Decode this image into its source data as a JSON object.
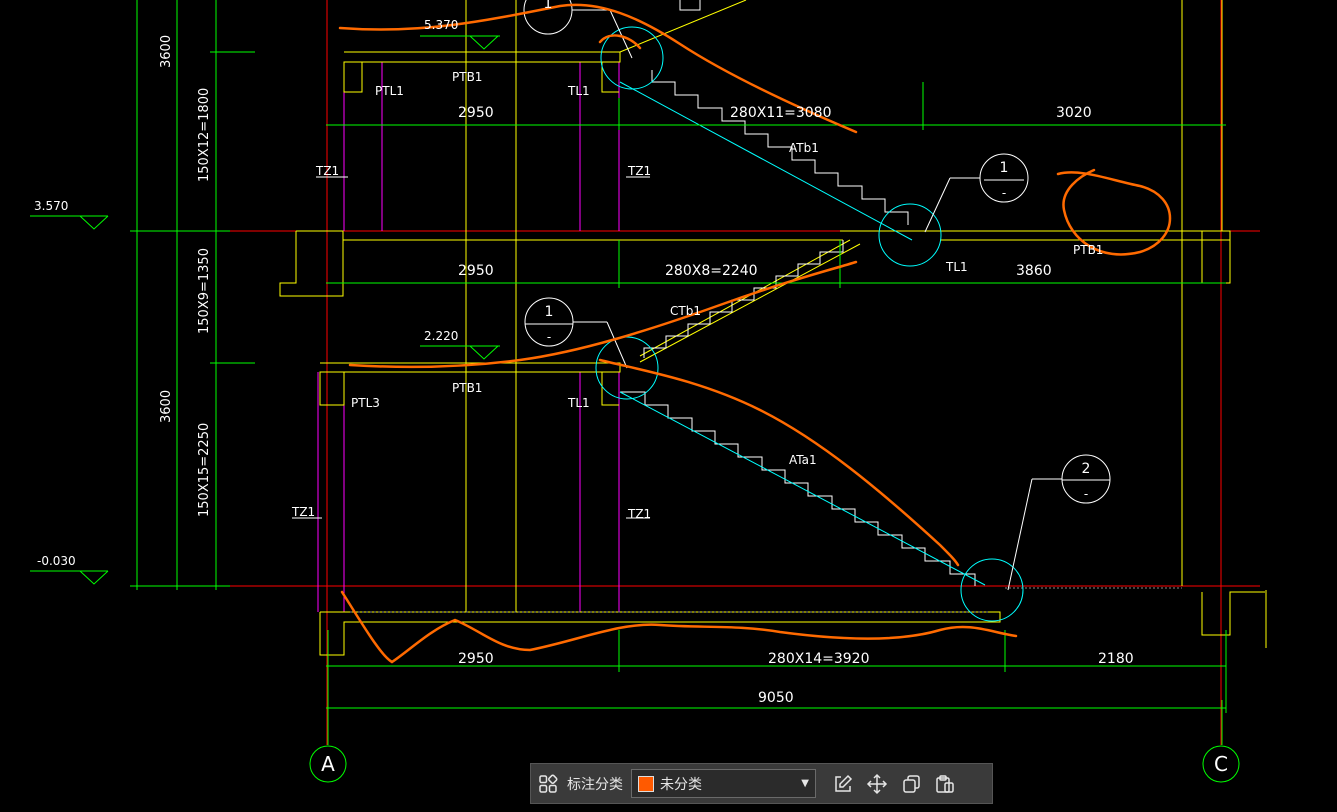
{
  "drawing": {
    "elevations": [
      "5.370",
      "3.570",
      "2.220",
      "-0.030"
    ],
    "vertical_dims": [
      "3600",
      "150X12=1800",
      "150X9=1350",
      "3600",
      "150X15=2250"
    ],
    "horizontal_dims": {
      "upper_left": "2950",
      "upper_run": "280X11=3080",
      "upper_right": "3020",
      "mid_left": "2950",
      "mid_run": "280X8=2240",
      "mid_right": "3860",
      "bottom_left": "2950",
      "bottom_run": "280X14=3920",
      "bottom_right": "2180",
      "total": "9050"
    },
    "labels": {
      "ptl1": "PTL1",
      "ptb1_top": "PTB1",
      "tl1_top": "TL1",
      "tz1_a": "TZ1",
      "tz1_b": "TZ1",
      "atb1": "ATb1",
      "tl1_mid": "TL1",
      "ptb1_right": "PTB1",
      "ctb1": "CTb1",
      "ptl3": "PTL3",
      "ptb1_low": "PTB1",
      "tl1_low": "TL1",
      "ata1": "ATa1",
      "tz1_c": "TZ1",
      "tz1_d": "TZ1"
    },
    "detail_callouts": [
      {
        "num": "1",
        "sub": "-"
      },
      {
        "num": "1",
        "sub": "-"
      },
      {
        "num": "1",
        "sub": "-"
      },
      {
        "num": "2",
        "sub": "-"
      }
    ],
    "axes": [
      "A",
      "C"
    ]
  },
  "colors": {
    "background": "#000000",
    "dimension": "#00ff00",
    "structure": "#ffff00",
    "stair_line": "#00ffff",
    "column": "#ff00ff",
    "axis_red": "#ff0000",
    "text": "#ffffff",
    "markup": "#ff6a00"
  },
  "toolbar": {
    "classify_label": "标注分类",
    "category_value": "未分类",
    "category_color": "#ff5a00",
    "icons": [
      "grid-icon",
      "edit-icon",
      "move-icon",
      "copy-icon",
      "paste-icon"
    ]
  }
}
